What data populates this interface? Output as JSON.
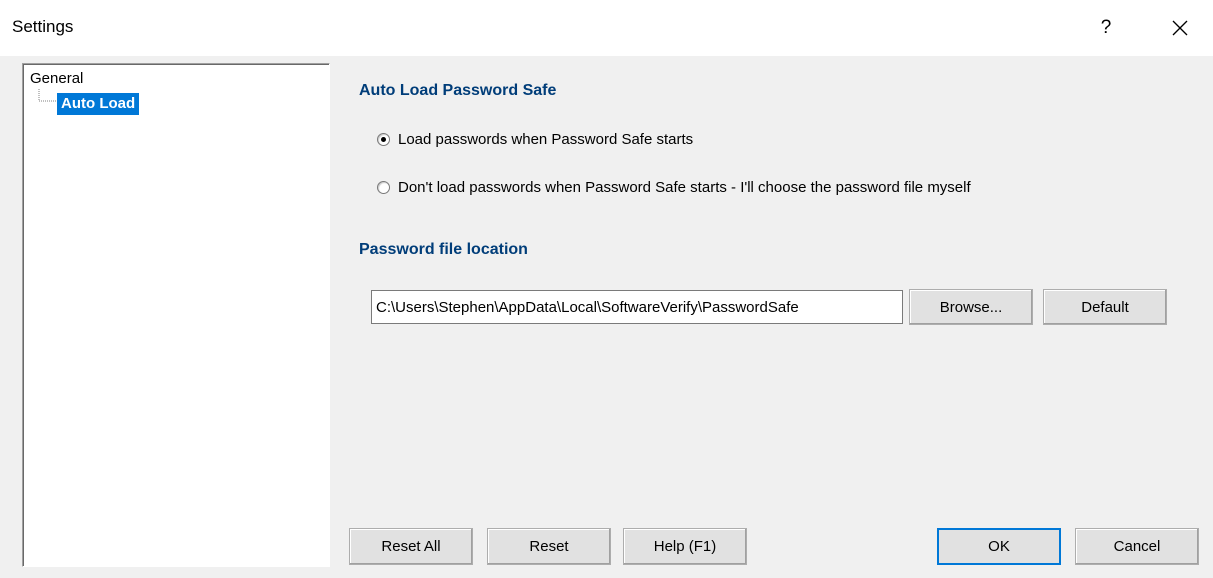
{
  "window": {
    "title": "Settings",
    "help_label": "?"
  },
  "tree": {
    "root_label": "General",
    "child_label": "Auto Load"
  },
  "autoload": {
    "heading": "Auto Load Password Safe",
    "option_load": "Load passwords when Password Safe starts",
    "option_dont_load": "Don't load passwords when Password Safe starts - I'll choose the password file myself",
    "selected_option": "load"
  },
  "location": {
    "heading": "Password file location",
    "path_value": "C:\\Users\\Stephen\\AppData\\Local\\SoftwareVerify\\PasswordSafe",
    "browse_label": "Browse...",
    "default_label": "Default"
  },
  "footer": {
    "reset_all_label": "Reset All",
    "reset_label": "Reset",
    "help_label": "Help (F1)",
    "ok_label": "OK",
    "cancel_label": "Cancel"
  },
  "colors": {
    "selection": "#0078d7",
    "heading": "#003d79"
  }
}
